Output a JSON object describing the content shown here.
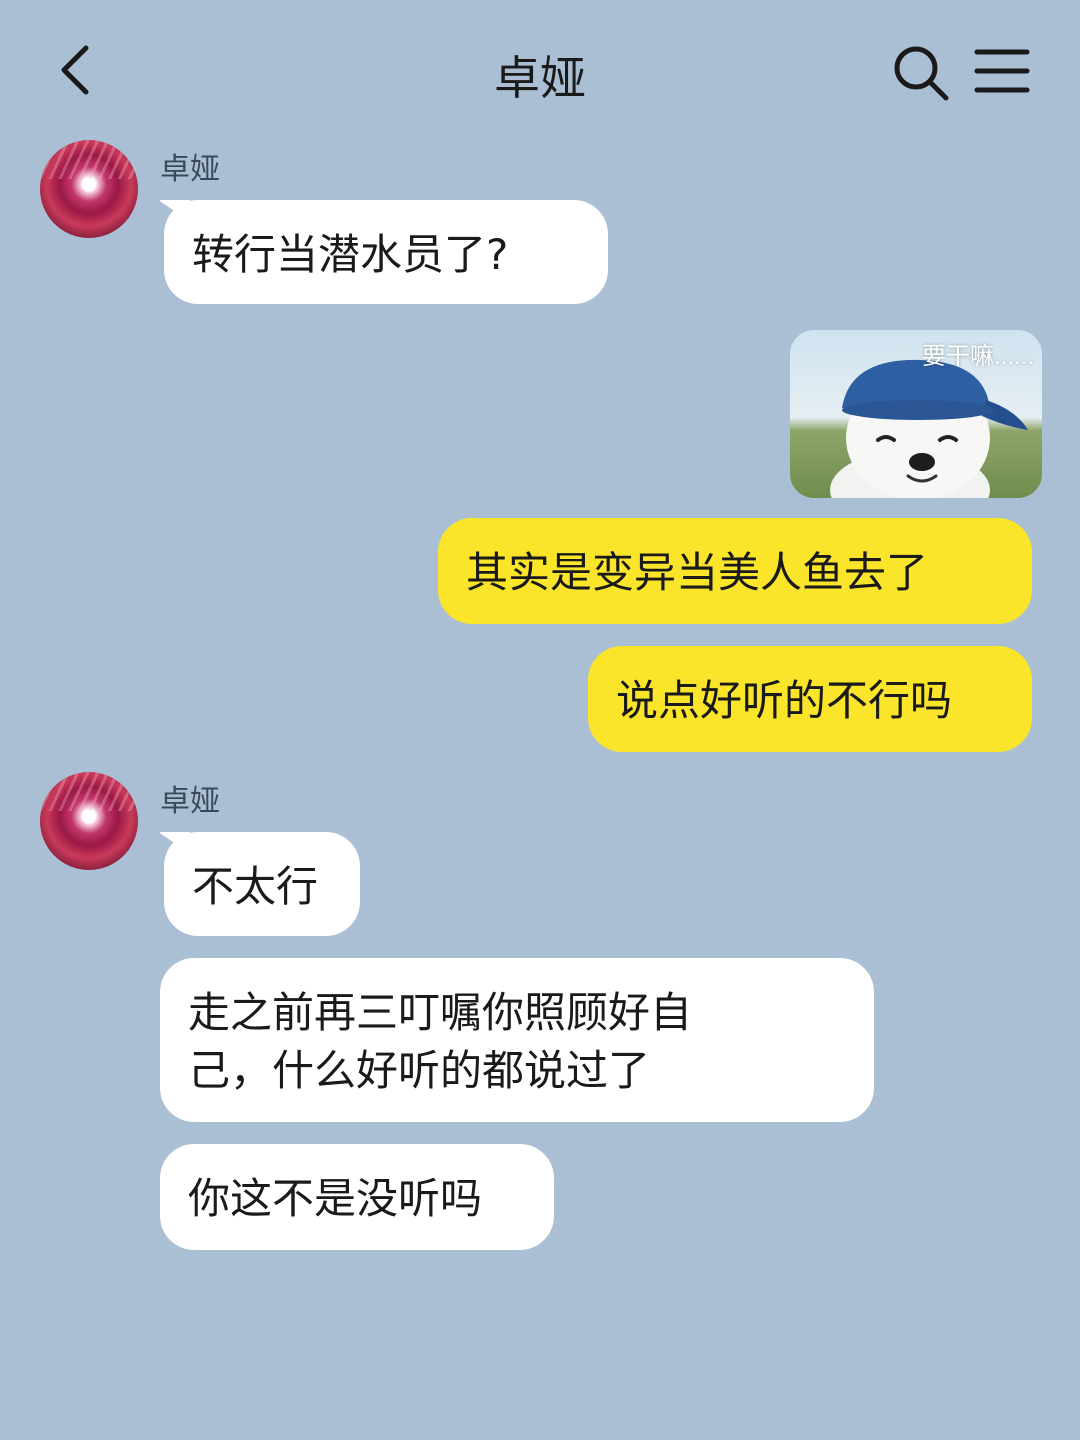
{
  "header": {
    "title": "卓娅",
    "back_icon": "chevron-left-icon",
    "search_icon": "search-icon",
    "menu_icon": "hamburger-menu-icon"
  },
  "colors": {
    "background": "#aabfd3",
    "incoming_bubble": "#ffffff",
    "outgoing_bubble": "#fbe52b"
  },
  "messages": [
    {
      "sender": "卓娅",
      "text": "转行当潜水员了?"
    },
    {
      "sender": "me",
      "sticker_caption": "要干嘛......",
      "sticker": "dog-in-blue-cap"
    },
    {
      "sender": "me",
      "text": "其实是变异当美人鱼去了"
    },
    {
      "sender": "me",
      "text": "说点好听的不行吗"
    },
    {
      "sender": "卓娅",
      "text": "不太行"
    },
    {
      "sender": "卓娅",
      "text": "走之前再三叮嘱你照顾好自\n己，什么好听的都说过了"
    },
    {
      "sender": "卓娅",
      "text": "你这不是没听吗"
    }
  ]
}
